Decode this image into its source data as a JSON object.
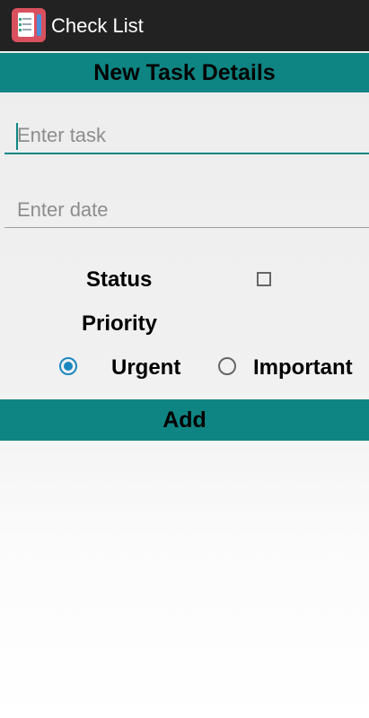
{
  "app": {
    "title": "Check List",
    "icon": "checklist-icon"
  },
  "form": {
    "header": "New Task Details",
    "task_placeholder": "Enter task",
    "task_value": "",
    "date_placeholder": "Enter date",
    "date_value": "",
    "status_label": "Status",
    "status_checked": false,
    "priority_label": "Priority",
    "priority_options": [
      {
        "label": "Urgent",
        "selected": true
      },
      {
        "label": "Important",
        "selected": false
      }
    ],
    "add_label": "Add"
  },
  "colors": {
    "accent": "#0f8583",
    "titlebar": "#222222",
    "radio_selected": "#1a88c0",
    "app_icon": "#d9515e"
  }
}
